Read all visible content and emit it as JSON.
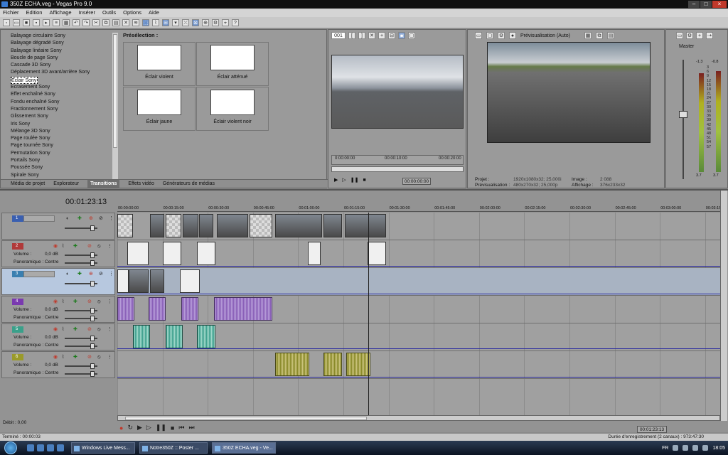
{
  "window": {
    "title": "350Z ECHA.veg - Vegas Pro 9.0"
  },
  "menu": [
    "Fichier",
    "Edition",
    "Affichage",
    "Insérer",
    "Outils",
    "Options",
    "Aide"
  ],
  "effects": {
    "items": [
      "Balayage circulaire Sony",
      "Balayage dégradé Sony",
      "Balayage linéaire Sony",
      "Boucle de page Sony",
      "Cascade 3D Sony",
      "Déplacement 3D avant/arrière Sony",
      "Éclair Sony",
      "Ecrasement Sony",
      "Effet enchaîné Sony",
      "Fondu enchaîné Sony",
      "Fractionnement Sony",
      "Glissement Sony",
      "Iris Sony",
      "Mélange 3D Sony",
      "Page roulée Sony",
      "Page tournée Sony",
      "Permutation Sony",
      "Portails Sony",
      "Poussée Sony",
      "Spirale Sony"
    ],
    "selected_index": 6,
    "preset_title": "Présélection :",
    "presets": [
      {
        "label": "Éclair violent"
      },
      {
        "label": "Éclair atténué"
      },
      {
        "label": "Éclair jaune"
      },
      {
        "label": "Éclair violent noir"
      }
    ],
    "tabs": [
      "Média de projet",
      "Explorateur",
      "Transitions",
      "Effets vidéo",
      "Générateurs de médias"
    ],
    "active_tab": "Transitions"
  },
  "trimmer": {
    "clip_selector": "001",
    "ruler": [
      "0:00:00:00",
      "00:00:10:00",
      "00:00:20:00"
    ],
    "time": "00:00:00:00"
  },
  "preview": {
    "mode": "Prévisualisation (Auto)",
    "info": {
      "projet_label": "Projet :",
      "projet": "1920x1080x32; 25,000i",
      "previsualisation_label": "Prévisualisation :",
      "previsualisation": "480x270x32; 25,000p",
      "image_label": "Image :",
      "image": "2 088",
      "affichage_label": "Affichage :",
      "affichage": "376x233x32"
    }
  },
  "mixer": {
    "label": "Master",
    "peak_left": "-1.3",
    "peak_right": "-0.8",
    "scale": [
      "3",
      "6",
      "9",
      "12",
      "15",
      "18",
      "21",
      "24",
      "27",
      "30",
      "33",
      "36",
      "39",
      "42",
      "45",
      "48",
      "51",
      "54",
      "57"
    ],
    "foot_left": "3.7",
    "foot_right": "3.7",
    "level_left": 0.93,
    "level_right": 0.95
  },
  "timeline": {
    "time": "00:01:23:13",
    "ruler": [
      "00:00:00:00",
      "00:00:15:00",
      "00:00:30:00",
      "00:00:45:00",
      "00:01:00:00",
      "00:01:15:00",
      "00:01:30:00",
      "00:01:45:00",
      "00:02:00:00",
      "00:02:15:00",
      "00:02:30:00",
      "00:02:45:00",
      "00:03:00:00",
      "00:03:15:00"
    ],
    "tracks": [
      {
        "number": "1",
        "type": "video",
        "color": "#3a5fb0"
      },
      {
        "number": "2",
        "type": "video",
        "color": "#b03a3a",
        "volume_label": "Volume :",
        "volume": "0,0 dB",
        "pan_label": "Panoramique :",
        "pan": "Centre"
      },
      {
        "number": "3",
        "type": "video",
        "color": "#3a7fb0"
      },
      {
        "number": "4",
        "type": "audio",
        "color": "#7a3ab0",
        "volume_label": "Volume :",
        "volume": "0,0 dB",
        "pan_label": "Panoramique :",
        "pan": "Centre"
      },
      {
        "number": "5",
        "type": "audio",
        "color": "#3aa08a",
        "volume_label": "Volume :",
        "volume": "0,0 dB",
        "pan_label": "Panoramique :",
        "pan": "Centre"
      },
      {
        "number": "6",
        "type": "audio",
        "color": "#9a9a2a",
        "volume_label": "Volume :",
        "volume": "0,0 dB",
        "pan_label": "Panoramique :",
        "pan": "Centre"
      }
    ],
    "debit": "Débit : 0,00",
    "end_time": "00:01:23:13"
  },
  "status": {
    "left": "Terminé : 00:00:03",
    "right": "Durée d'enregistrement (2 canaux) : 973:47:30"
  },
  "taskbar": {
    "items": [
      "Windows Live Mess...",
      "Notre350Z :: Poster ...",
      "350Z ECHA.veg - Ve..."
    ],
    "lang": "FR",
    "clock": "18:05"
  },
  "colors": {
    "panel": "#9a9a9a",
    "selected_track": "#b7c8df",
    "envelope": "#2a2aa0"
  }
}
